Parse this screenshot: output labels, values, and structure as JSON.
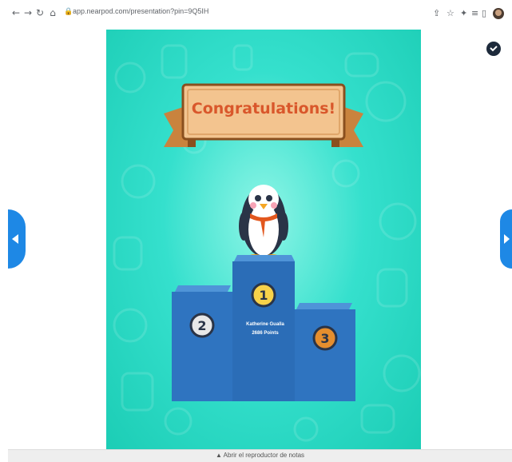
{
  "browser": {
    "url": "app.nearpod.com/presentation?pin=9Q5IH",
    "icons": [
      "back-icon",
      "forward-icon",
      "reload-icon",
      "home-icon",
      "lock-icon",
      "share-icon",
      "star-icon",
      "extensions-icon",
      "reading-list-icon",
      "side-panel-icon",
      "profile-avatar"
    ]
  },
  "slide": {
    "banner_text": "Congratulations!",
    "podium": [
      {
        "place": "1",
        "name": "Katherine Gualla",
        "points": "2686 Points"
      },
      {
        "place": "2"
      },
      {
        "place": "3"
      }
    ],
    "colors": {
      "background": "#1ecfb7",
      "podium": "#2f74c0",
      "banner": "#e9b783",
      "banner_text": "#d9572b"
    }
  },
  "controls": {
    "notes_toggle": "▲ Abrir el reproductor de notas"
  }
}
